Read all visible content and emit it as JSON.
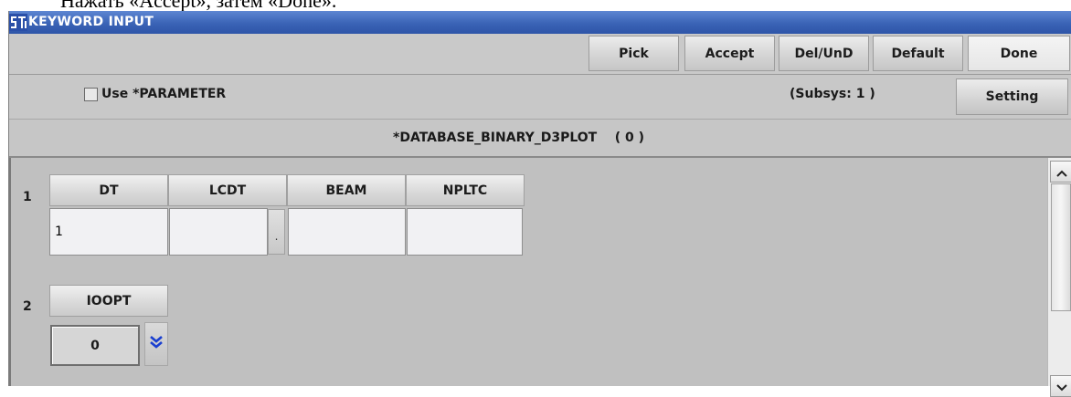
{
  "caption": "Нажать «Accept», затем «Done».",
  "window": {
    "title": "KEYWORD INPUT"
  },
  "toolbar": {
    "pick": "Pick",
    "accept": "Accept",
    "del_und": "Del/UnD",
    "default": "Default",
    "done": "Done"
  },
  "options": {
    "use_parameter_label": "Use *PARAMETER",
    "use_parameter_checked": false,
    "subsys": "(Subsys: 1 )",
    "setting": "Setting"
  },
  "keyword": {
    "title": "*DATABASE_BINARY_D3PLOT    ( 0 )"
  },
  "cards": [
    {
      "number": "1",
      "fields": [
        {
          "name": "DT",
          "value": "1"
        },
        {
          "name": "LCDT",
          "value": ""
        },
        {
          "name": "BEAM",
          "value": ""
        },
        {
          "name": "NPLTC",
          "value": ""
        }
      ],
      "lcdt_button": "."
    },
    {
      "number": "2",
      "fields": [
        {
          "name": "IOOPT",
          "value": "0"
        }
      ]
    }
  ],
  "colors": {
    "titlebar": "#3a63b6",
    "panel": "#c0c0c0",
    "dropdown_arrow": "#1a3fd0"
  }
}
